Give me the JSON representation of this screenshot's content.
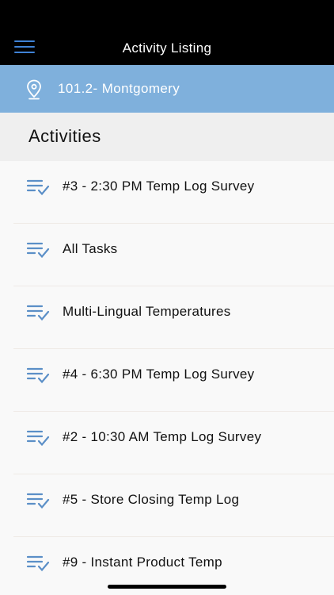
{
  "header": {
    "title": "Activity Listing",
    "menu_icon": "hamburger-menu-icon"
  },
  "location": {
    "icon": "location-pin-icon",
    "name": "101.2-  Montgomery"
  },
  "section": {
    "title": "Activities"
  },
  "activities": [
    {
      "label": "#3 - 2:30 PM Temp Log Survey",
      "icon": "task-list-check-icon"
    },
    {
      "label": "All  Tasks",
      "icon": "task-list-check-icon"
    },
    {
      "label": "Multi-Lingual Temperatures",
      "icon": "task-list-check-icon"
    },
    {
      "label": "#4 - 6:30 PM Temp Log Survey",
      "icon": "task-list-check-icon"
    },
    {
      "label": "#2 - 10:30 AM Temp Log Survey",
      "icon": "task-list-check-icon"
    },
    {
      "label": "#5 - Store Closing Temp Log",
      "icon": "task-list-check-icon"
    },
    {
      "label": "#9 - Instant Product Temp",
      "icon": "task-list-check-icon"
    }
  ],
  "colors": {
    "accent": "#3f82d6",
    "location_bar": "#7fb0dc",
    "icon": "#5b8fc7"
  }
}
